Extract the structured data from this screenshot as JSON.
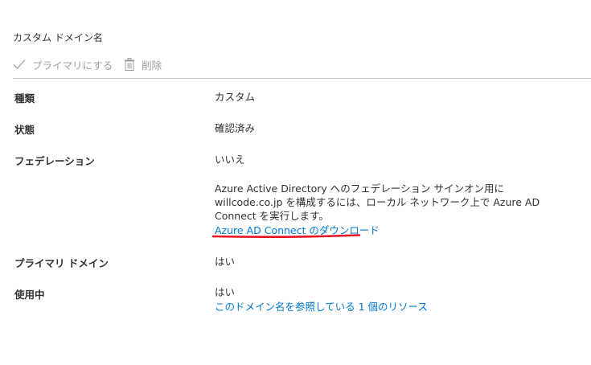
{
  "header": {
    "title": "カスタム ドメイン名"
  },
  "toolbar": {
    "make_primary_label": "プライマリにする",
    "delete_label": "削除"
  },
  "properties": {
    "type_label": "種類",
    "type_value": "カスタム",
    "status_label": "状態",
    "status_value": "確認済み",
    "federation_label": "フェデレーション",
    "federation_value": "いいえ",
    "federation_description": "Azure Active Directory へのフェデレーション サインオン用に willcode.co.jp を構成するには、ローカル ネットワーク上で Azure AD Connect を実行します。",
    "download_link": "Azure AD Connect のダウンロード",
    "primary_domain_label": "プライマリ ドメイン",
    "primary_domain_value": "はい",
    "in_use_label": "使用中",
    "in_use_value": "はい",
    "in_use_link": "このドメイン名を参照している 1 個のリソース"
  },
  "colors": {
    "link": "#0078d4",
    "annotation": "#e81123",
    "disabled": "#a19f9d",
    "divider": "#c8c6c4"
  },
  "icons": {
    "make_primary": "checkmark-icon",
    "delete": "trash-icon"
  }
}
